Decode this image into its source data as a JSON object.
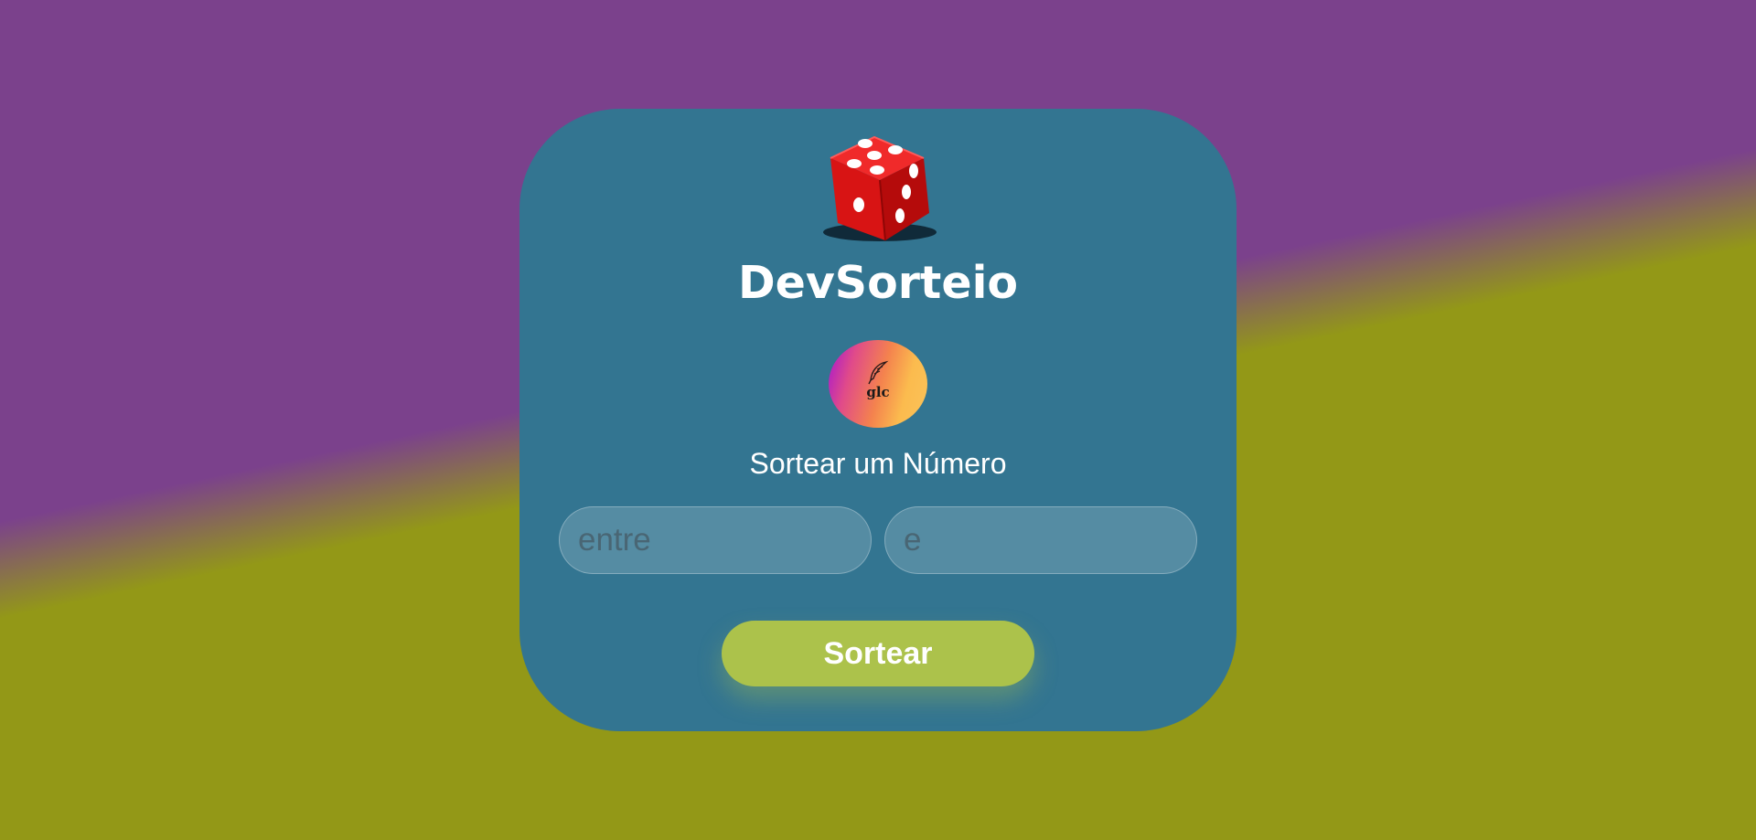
{
  "app": {
    "title": "DevSorteio",
    "logo_text": "glc",
    "subtitle": "Sortear um Número"
  },
  "form": {
    "min_placeholder": "entre",
    "max_placeholder": "e",
    "min_value": "",
    "max_value": "",
    "submit_label": "Sortear"
  },
  "icons": {
    "hero": "dice-icon",
    "logo": "feather-quill-icon"
  },
  "colors": {
    "background_top": "#7b418c",
    "background_bottom": "#939817",
    "card": "#337591",
    "button": "#acc24b",
    "dice": "#e01010",
    "text": "#ffffff"
  }
}
